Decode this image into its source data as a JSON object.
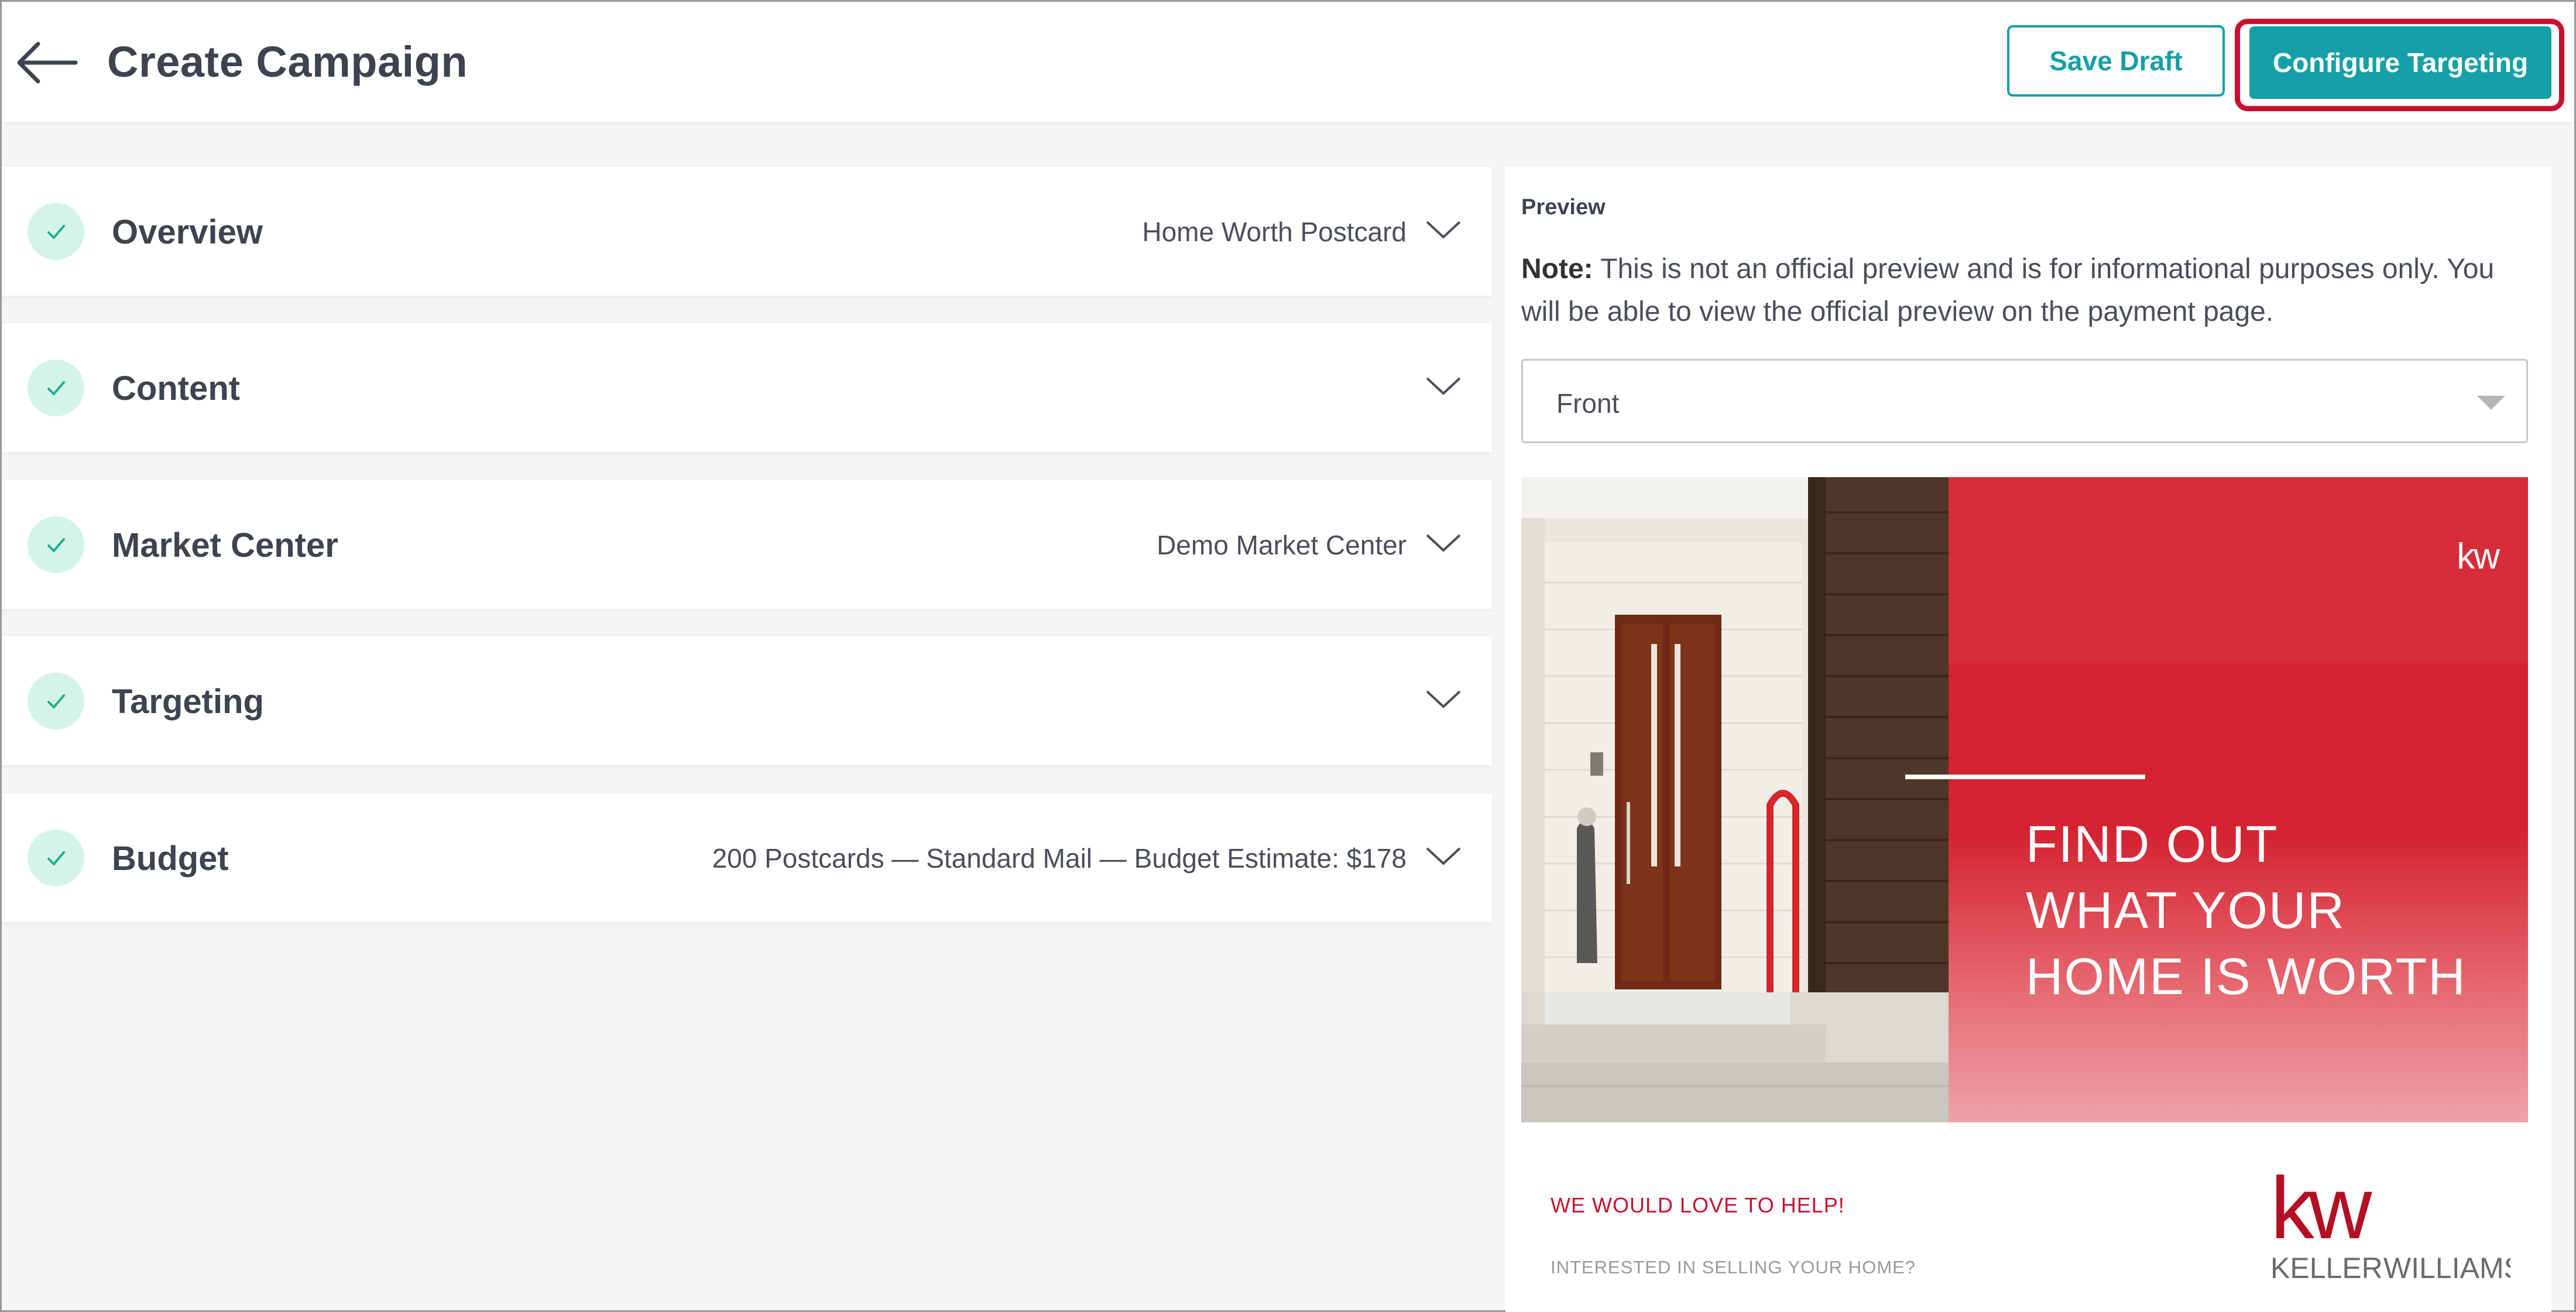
{
  "header": {
    "title": "Create Campaign",
    "save_draft": "Save Draft",
    "configure_targeting": "Configure Targeting"
  },
  "sections": [
    {
      "title": "Overview",
      "summary": "Home Worth Postcard"
    },
    {
      "title": "Content",
      "summary": ""
    },
    {
      "title": "Market Center",
      "summary": "Demo Market Center"
    },
    {
      "title": "Targeting",
      "summary": ""
    },
    {
      "title": "Budget",
      "summary": "200 Postcards — Standard Mail — Budget Estimate: $178"
    }
  ],
  "preview": {
    "label": "Preview",
    "note_label": "Note:",
    "note_text": " This is not an official preview and is for informational purposes only. You will be able to view the official preview on the payment page.",
    "select_value": "Front",
    "card": {
      "headline_lines": [
        "FIND OUT",
        "WHAT YOUR",
        "HOME IS WORTH"
      ],
      "help_text": "WE WOULD LOVE TO HELP!",
      "sub_text": "INTERESTED IN SELLING YOUR HOME?",
      "logo_small": "kw",
      "logo_mark": "kw",
      "logo_name_left": "KELLER",
      "logo_name_right": "WILLIAMS"
    }
  },
  "colors": {
    "accent": "#15a0a8",
    "highlight_border": "#c8102e",
    "check_bg": "#d4f4ea",
    "brand_red": "#d42231"
  },
  "icons": {
    "back": "arrow-left-icon",
    "check": "check-icon",
    "expand": "chevron-down-icon",
    "select": "caret-down-icon"
  }
}
